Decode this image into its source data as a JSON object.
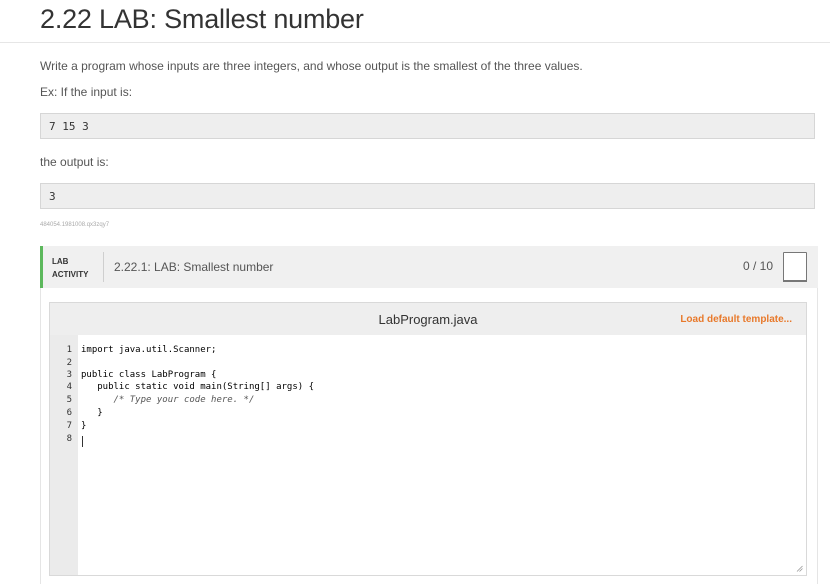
{
  "heading": {
    "title": "2.22 LAB: Smallest number"
  },
  "prompt": {
    "description": "Write a program whose inputs are three integers, and whose output is the smallest of the three values.",
    "example_intro": "Ex: If the input is:",
    "example_input": "7 15 3",
    "output_intro": "the output is:",
    "example_output": "3",
    "tracking_id": "484054.1981008.qx3zqy7"
  },
  "lab": {
    "label_line1": "LAB",
    "label_line2": "ACTIVITY",
    "name": "2.22.1: LAB: Smallest number",
    "score": "0 / 10",
    "accent_color": "#5cb85c"
  },
  "editor": {
    "file_name": "LabProgram.java",
    "load_template_label": "Load default template...",
    "load_template_color": "#e8792b",
    "line_numbers": [
      "1",
      "2",
      "3",
      "4",
      "5",
      "6",
      "7",
      "8"
    ],
    "lines": [
      "import java.util.Scanner;",
      "",
      "public class LabProgram {",
      "   public static void main(String[] args) {",
      "      /* Type your code here. */",
      "   }",
      "}",
      ""
    ]
  }
}
